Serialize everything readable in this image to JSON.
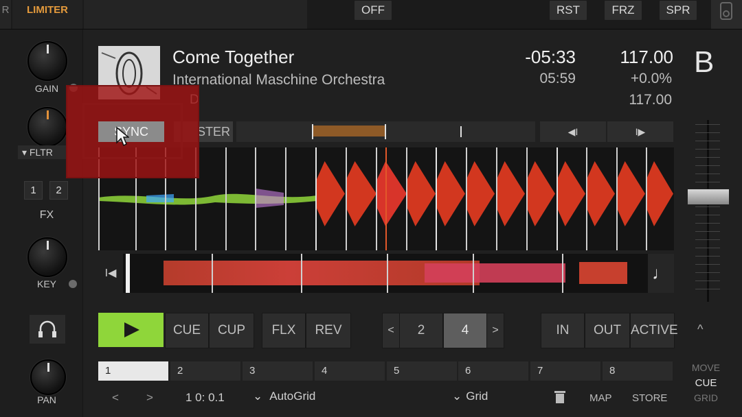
{
  "topbar": {
    "limiter_label": "LIMITER",
    "off_label": "OFF",
    "rst_label": "RST",
    "frz_label": "FRZ",
    "spr_label": "SPR",
    "left_cut_label": "R"
  },
  "mixer": {
    "gain_label": "GAIN",
    "filter_label": "FLTR",
    "fx_label": "FX",
    "fx_buttons": [
      "1",
      "2"
    ],
    "key_label": "KEY",
    "pan_label": "PAN"
  },
  "track": {
    "title": "Come Together",
    "artist": "International Maschine Orchestra",
    "key_fragment": "D",
    "remaining_time": "-05:33",
    "total_time": "05:59",
    "bpm": "117.00",
    "pitch": "+0.0%",
    "original_bpm": "117.00",
    "deck_letter": "B"
  },
  "sync": {
    "sync_label": "SYNC",
    "master_label": "STER"
  },
  "transport": {
    "play_icon": "play-icon",
    "cue_label": "CUE",
    "cup_label": "CUP",
    "flx_label": "FLX",
    "rev_label": "REV",
    "loop_left": "<",
    "loop_size_a": "2",
    "loop_size_b": "4",
    "loop_right": ">",
    "in_label": "IN",
    "out_label": "OUT",
    "active_label": "ACTIVE",
    "collapse": "^"
  },
  "cues": {
    "slots": [
      "1",
      "2",
      "3",
      "4",
      "5",
      "6",
      "7",
      "8"
    ],
    "move_label": "MOVE",
    "cue_label": "CUE",
    "grid_label": "GRID"
  },
  "footer": {
    "prev": "<",
    "next": ">",
    "position": "1 0: 0.1",
    "autogrid": "AutoGrid",
    "grid": "Grid",
    "map": "MAP",
    "store": "STORE"
  },
  "colors": {
    "play_green": "#8fd63a",
    "waveform_red": "#d2371f",
    "highlight_red": "#b11e1e",
    "limiter_orange": "#e49a3c"
  }
}
